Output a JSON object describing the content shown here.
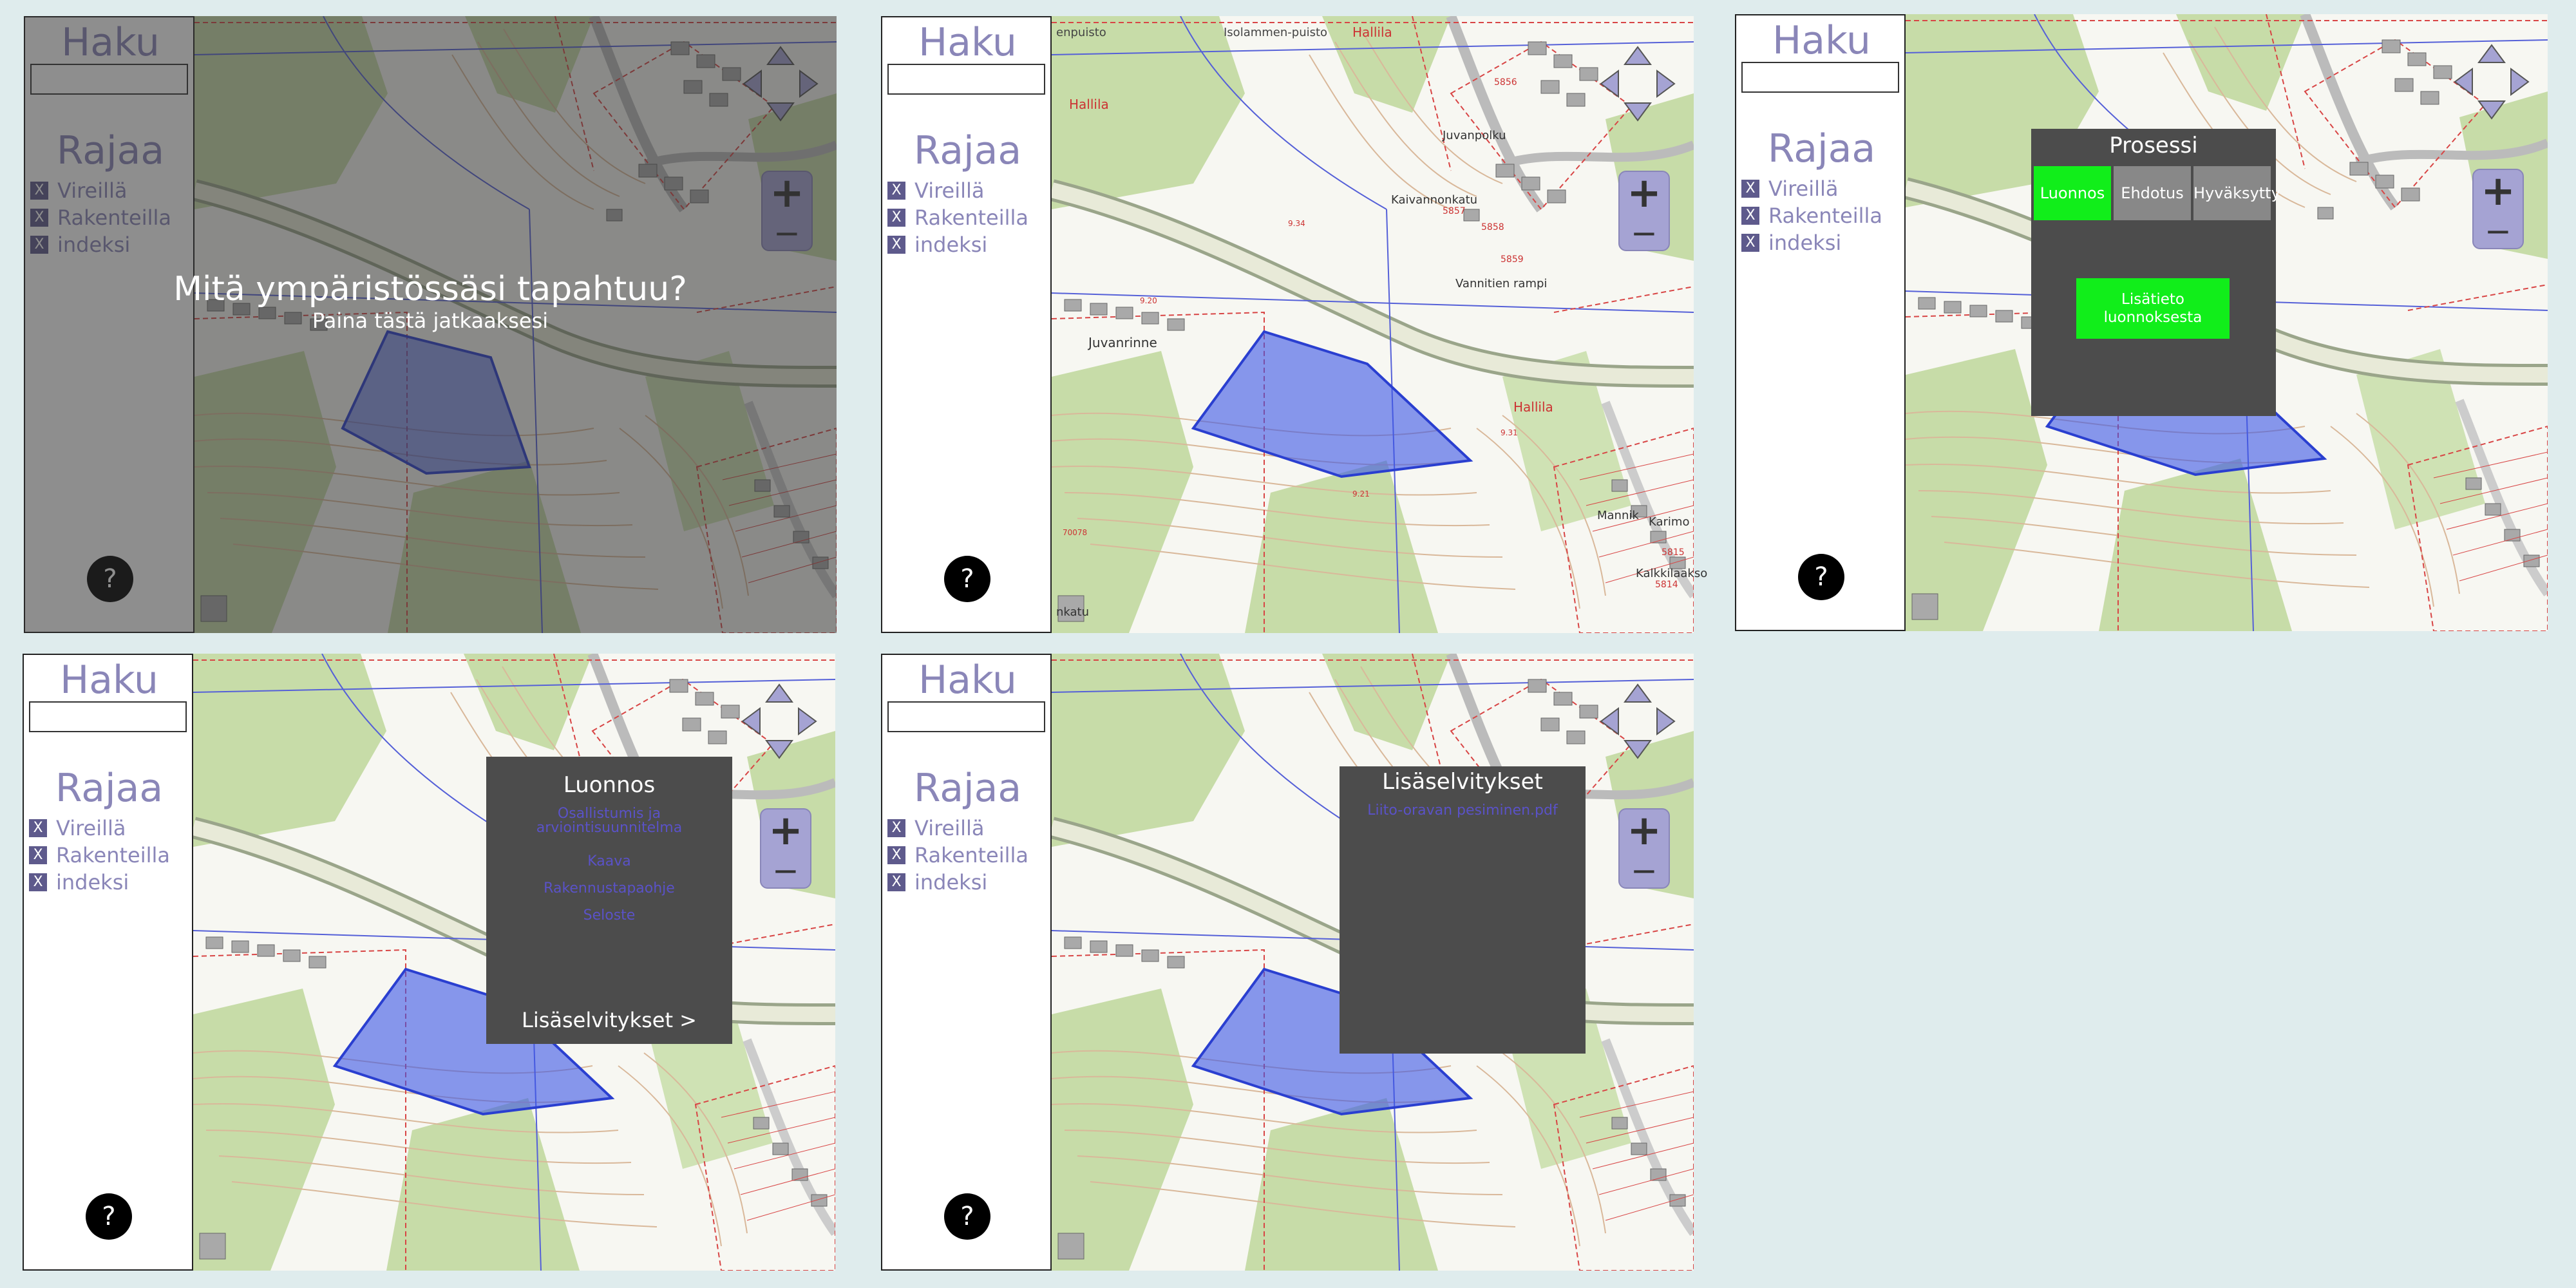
{
  "sidebar": {
    "search_title": "Haku",
    "filter_title": "Rajaa",
    "checkbox_mark": "X",
    "filters": [
      "Vireillä",
      "Rakenteilla",
      "indeksi"
    ],
    "help_label": "?"
  },
  "map": {
    "labels": [
      "Isolammen-puisto",
      "enpuisto",
      "Hallila",
      "Hallila",
      "Hallila",
      "Juvanrinne",
      "Kaivannonkatu",
      "Juvanpolku",
      "Vannitien rampi",
      "Karimo",
      "Mannik",
      "Kalkkilaakso",
      "nkatu"
    ],
    "numbers": [
      "5856",
      "5857",
      "5858",
      "5859",
      "5815",
      "5814",
      "9.34",
      "9.31",
      "9.20",
      "9.21",
      "70078"
    ],
    "zoom_in": "+",
    "zoom_out": "−"
  },
  "intro": {
    "title": "Mitä ympäristössäsi tapahtuu?",
    "subtitle": "Paina tästä jatkaaksesi"
  },
  "process": {
    "title": "Prosessi",
    "tabs": [
      "Luonnos",
      "Ehdotus",
      "Hyväksytty"
    ],
    "info_button": "Lisätieto luonnoksesta"
  },
  "draft": {
    "title": "Luonnos",
    "documents": [
      "Osallistumis ja arviointisuunnitelma",
      "Kaava",
      "Rakennustapaohje",
      "Seloste"
    ],
    "more_link": "Lisäselvitykset >"
  },
  "surveys": {
    "title": "Lisäselvitykset",
    "documents": [
      "Liito-oravan pesiminen.pdf"
    ]
  },
  "colors": {
    "background": "#dfeced",
    "accent": "#11ee1a",
    "sidebar_text": "#8a86b8",
    "popup": "#4c4c4c",
    "plan_area": "#3a55e6"
  }
}
